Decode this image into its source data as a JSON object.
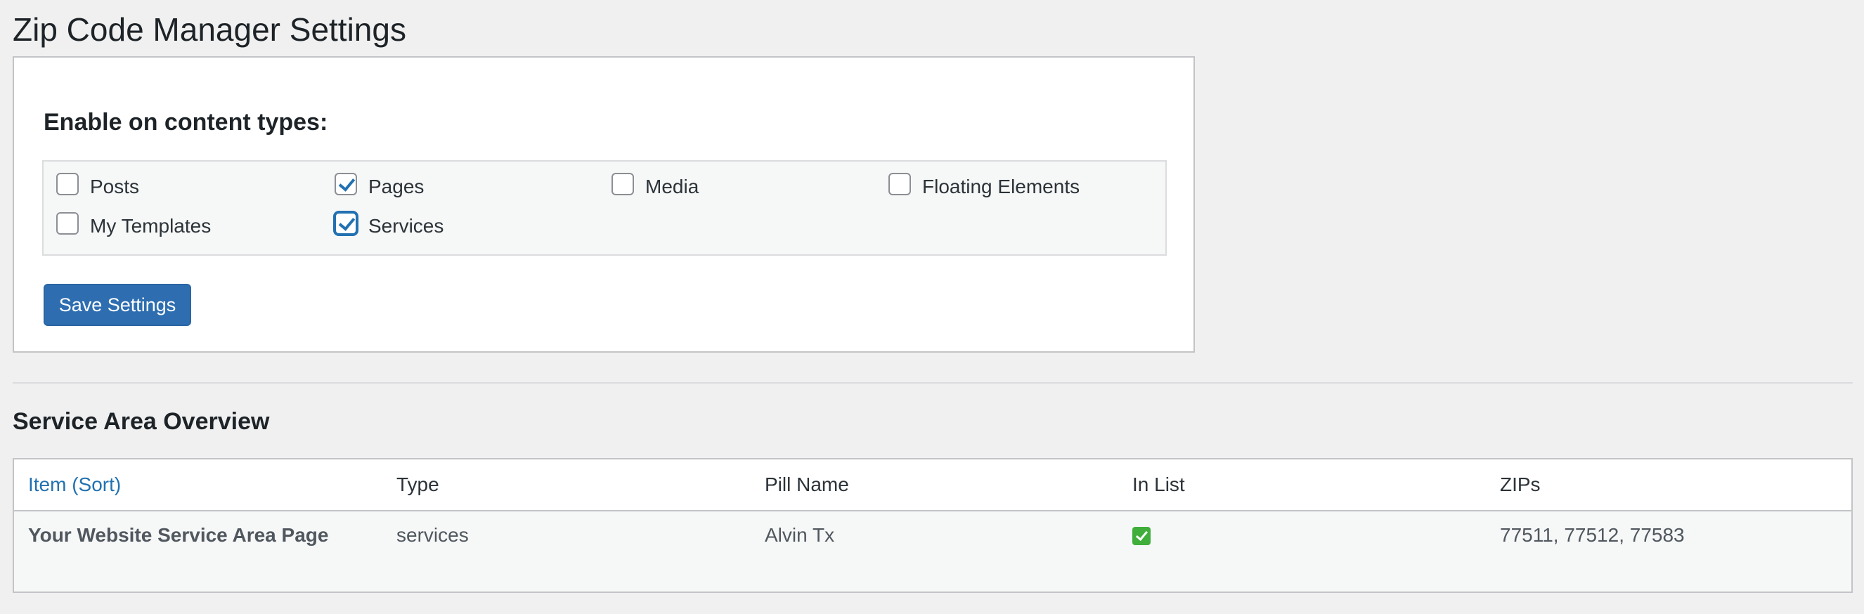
{
  "page": {
    "title": "Zip Code Manager Settings"
  },
  "settings": {
    "heading": "Enable on content types:",
    "content_types": [
      {
        "label": "Posts",
        "checked": false
      },
      {
        "label": "Pages",
        "checked": true
      },
      {
        "label": "Media",
        "checked": false
      },
      {
        "label": "Floating Elements",
        "checked": false
      },
      {
        "label": "My Templates",
        "checked": false
      },
      {
        "label": "Services",
        "checked": true,
        "focused": true
      }
    ],
    "save_label": "Save Settings"
  },
  "overview": {
    "heading": "Service Area Overview",
    "columns": [
      "Item (Sort)",
      "Type",
      "Pill Name",
      "In List",
      "ZIPs"
    ],
    "rows": [
      {
        "item": "Your Website Service Area Page",
        "type": "services",
        "pill_name": "Alvin Tx",
        "in_list": true,
        "in_list_icon": "green-checkmark-emoji",
        "zips": "77511, 77512, 77583"
      }
    ]
  },
  "colors": {
    "accent": "#2271b1",
    "button": "#2e6eb0",
    "background": "#f0f0f1",
    "check_green": "#3fae3a"
  }
}
